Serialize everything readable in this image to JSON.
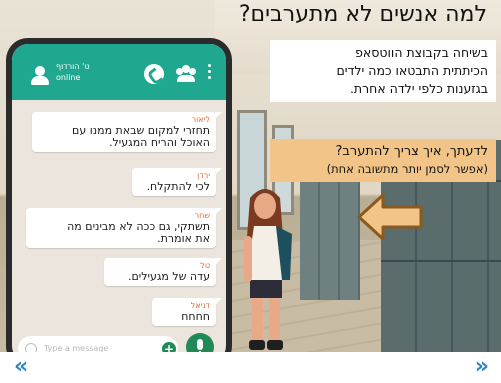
{
  "slide": {
    "title": "למה אנשים לא מתערבים?",
    "description": [
      "בשיחה בקבוצת הווטסאפ",
      "הכיתתית התבטאו כמה ילדים",
      "בגזענות כלפי ילדה אחרת."
    ],
    "question": {
      "line1": "לדעתך, איך צריך להתערב?",
      "line2": "(אפשר לסמן יותר מתשובה אחת)"
    }
  },
  "chat": {
    "group_name": "ט' הורדוף",
    "status": "online",
    "input_placeholder": "Type a message",
    "messages": [
      {
        "sender": "ליאור",
        "lines": [
          "תחזרי למקום שבאת ממנו עם",
          "האוכל והריח המגעיל."
        ]
      },
      {
        "sender": "ירדן",
        "lines": [
          "לכי להתקלח."
        ]
      },
      {
        "sender": "שחר",
        "lines": [
          "תשתקי, גם ככה לא מבינים מה",
          "את אומרת."
        ]
      },
      {
        "sender": "טל",
        "lines": [
          "עדה של מגעילים."
        ]
      },
      {
        "sender": "דניאל",
        "lines": [
          "חחחח"
        ]
      }
    ]
  },
  "navigation": {
    "prev": "«",
    "next": "»"
  },
  "colors": {
    "whatsapp_green": "#1fa88f",
    "sender_name": "#e06c2f",
    "question_bg": "#f2c487",
    "nav_arrow": "#2b86c8"
  }
}
